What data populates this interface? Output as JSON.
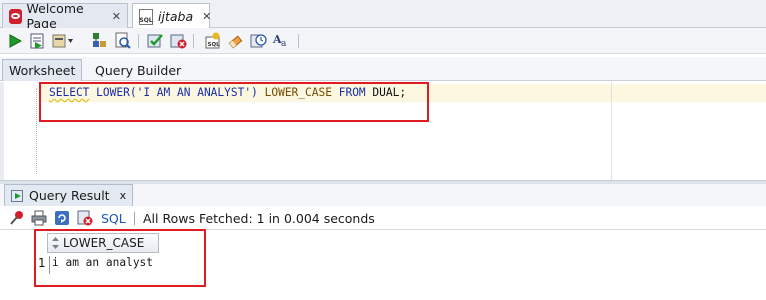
{
  "doc_tabs": [
    {
      "label": "Welcome Page",
      "icon": "oracle-icon"
    },
    {
      "label": "ijtaba",
      "icon": "sql-worksheet-icon",
      "icon_text": "SQL"
    }
  ],
  "toolbar": {
    "icons": [
      "run-statement-icon",
      "run-script-icon",
      "autotrace-icon",
      "explain-plan-icon",
      "sql-tuning-icon",
      "commit-icon",
      "rollback-icon",
      "unshared-sql-icon",
      "clear-icon",
      "sql-history-icon",
      "format-text-icon"
    ]
  },
  "worksheet_tabs": {
    "worksheet": "Worksheet",
    "query_builder": "Query Builder"
  },
  "editor": {
    "tokens": {
      "select": "SELECT",
      "func": "LOWER(",
      "str": "'I AM AN ANALYST'",
      "close": ")",
      "alias": "LOWER_CASE",
      "from": "FROM",
      "table": "DUAL;"
    }
  },
  "result": {
    "tab_label": "Query Result",
    "close": "x",
    "sql_link": "SQL",
    "status": "All Rows Fetched: 1 in 0.004 seconds",
    "column": "LOWER_CASE",
    "rows": [
      {
        "num": "1",
        "value": "i am an analyst"
      }
    ]
  },
  "colors": {
    "annotation_red": "#e11b22",
    "keyword_blue": "#1b2ea8",
    "link_blue": "#1d58b8"
  }
}
